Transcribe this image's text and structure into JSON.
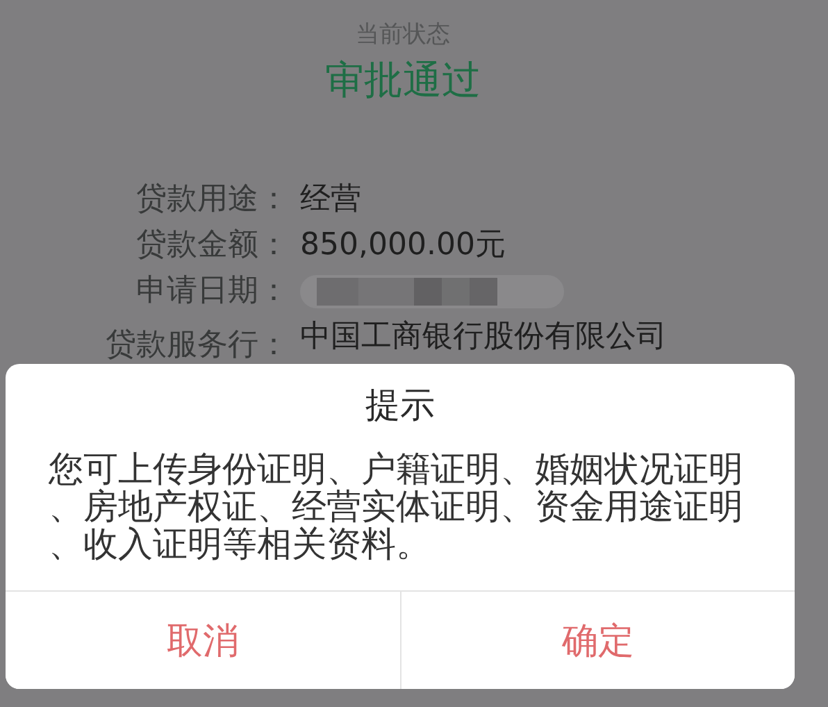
{
  "status": {
    "label": "当前状态",
    "value": "审批通过"
  },
  "details": [
    {
      "label": "贷款用途：",
      "value": "经营"
    },
    {
      "label": "贷款金额：",
      "value": "850,000.00元"
    },
    {
      "label": "申请日期：",
      "redacted": true
    },
    {
      "label": "贷款服务行：",
      "value": "中国工商银行股份有限公司"
    }
  ],
  "dialog": {
    "title": "提示",
    "message": "您可上传身份证明、户籍证明、婚姻状况证明、房地产权证、经营实体证明、资金用途证明、收入证明等相关资料。",
    "buttons": [
      {
        "label": "取消"
      },
      {
        "label": "确定"
      }
    ]
  }
}
